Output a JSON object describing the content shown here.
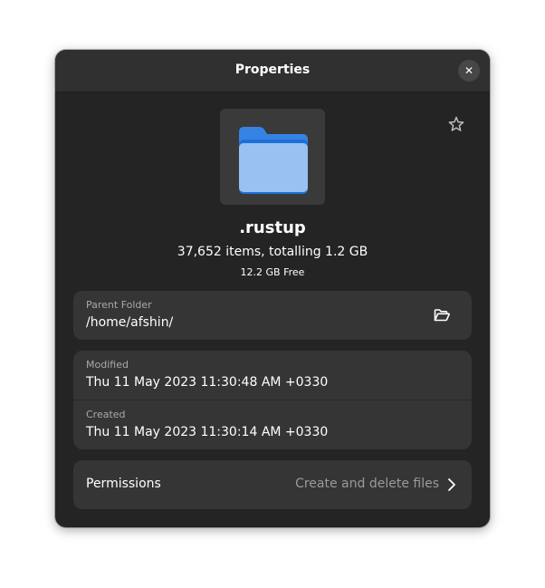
{
  "window": {
    "title": "Properties",
    "close_icon": "close-icon"
  },
  "file": {
    "icon": "folder-icon",
    "name": ".rustup",
    "summary": "37,652 items, totalling 1.2 GB",
    "free_space": "12.2 GB Free",
    "starred": false,
    "star_icon": "star-icon"
  },
  "parent_folder": {
    "label": "Parent Folder",
    "value": "/home/afshin/",
    "action_icon": "folder-open-icon"
  },
  "dates": {
    "modified_label": "Modified",
    "modified_value": "Thu 11 May 2023 11:30:48 AM +0330",
    "created_label": "Created",
    "created_value": "Thu 11 May 2023 11:30:14 AM +0330"
  },
  "permissions": {
    "label": "Permissions",
    "value": "Create and delete files",
    "chevron_icon": "chevron-right-icon"
  },
  "colors": {
    "window_bg": "#242424",
    "card_bg": "#353535",
    "folder_blue": "#99c1f1",
    "folder_tab": "#3584e4"
  }
}
